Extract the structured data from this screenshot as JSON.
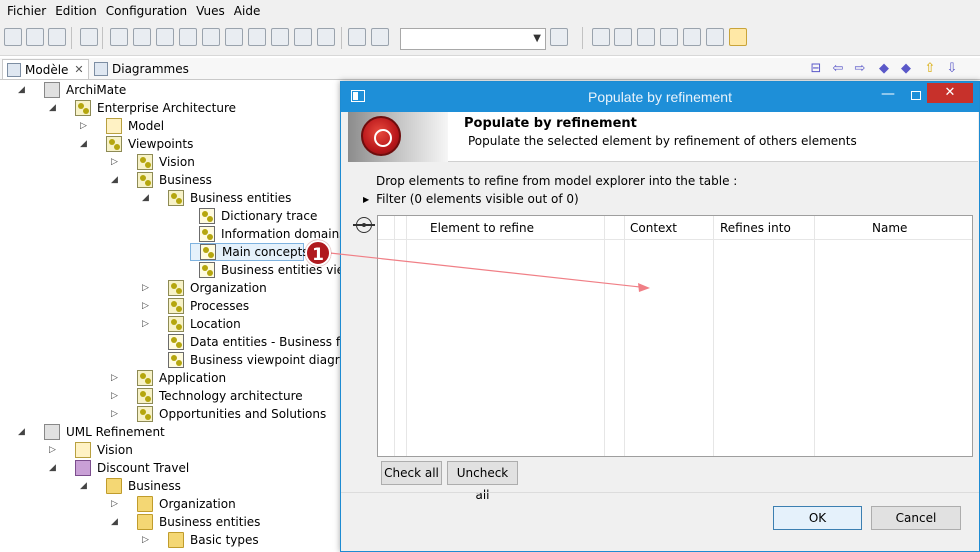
{
  "menu": [
    "Fichier",
    "Edition",
    "Configuration",
    "Vues",
    "Aide"
  ],
  "tabs": {
    "model": "Modèle",
    "model_close": "✕",
    "diagrams": "Diagrammes"
  },
  "tree": [
    {
      "label": "ArchiMate",
      "icon": "project-icon",
      "twisty": "expanded"
    },
    {
      "label": "Enterprise Architecture",
      "icon": "viewpoint-icon",
      "twisty": "expanded"
    },
    {
      "label": "Model",
      "icon": "package-icon",
      "twisty": "collapsed"
    },
    {
      "label": "Viewpoints",
      "icon": "viewpoint-icon",
      "twisty": "expanded"
    },
    {
      "label": "Vision",
      "icon": "viewpoint-icon",
      "twisty": "collapsed"
    },
    {
      "label": "Business",
      "icon": "viewpoint-icon",
      "twisty": "expanded"
    },
    {
      "label": "Business entities",
      "icon": "viewpoint-icon",
      "twisty": "expanded"
    },
    {
      "label": "Dictionary trace",
      "icon": "diagram-icon",
      "twisty": "none"
    },
    {
      "label": "Information domains",
      "icon": "diagram-icon",
      "twisty": "none"
    },
    {
      "label": "Main concepts",
      "icon": "diagram-icon",
      "twisty": "none"
    },
    {
      "label": "Business entities viewp",
      "icon": "diagram-icon",
      "twisty": "none"
    },
    {
      "label": "Organization",
      "icon": "viewpoint-icon",
      "twisty": "collapsed"
    },
    {
      "label": "Processes",
      "icon": "viewpoint-icon",
      "twisty": "collapsed"
    },
    {
      "label": "Location",
      "icon": "viewpoint-icon",
      "twisty": "collapsed"
    },
    {
      "label": "Data entities - Business func",
      "icon": "diagram-icon",
      "twisty": "none"
    },
    {
      "label": "Business viewpoint diagram",
      "icon": "diagram-icon",
      "twisty": "none"
    },
    {
      "label": "Application",
      "icon": "viewpoint-icon",
      "twisty": "collapsed"
    },
    {
      "label": "Technology architecture",
      "icon": "viewpoint-icon",
      "twisty": "collapsed"
    },
    {
      "label": "Opportunities and Solutions",
      "icon": "viewpoint-icon",
      "twisty": "collapsed"
    },
    {
      "label": "UML Refinement",
      "icon": "project-icon",
      "twisty": "expanded"
    },
    {
      "label": "Vision",
      "icon": "package-icon",
      "twisty": "collapsed"
    },
    {
      "label": "Discount Travel",
      "icon": "cube-icon",
      "twisty": "expanded"
    },
    {
      "label": "Business",
      "icon": "folder-icon",
      "twisty": "expanded"
    },
    {
      "label": "Organization",
      "icon": "folder-icon",
      "twisty": "collapsed"
    },
    {
      "label": "Business entities",
      "icon": "folder-icon",
      "twisty": "expanded"
    },
    {
      "label": "Basic types",
      "icon": "folder-icon",
      "twisty": "collapsed"
    }
  ],
  "badge": "1",
  "dialog": {
    "title": "Populate by refinement",
    "header_title": "Populate by refinement",
    "header_subtitle": "Populate the selected element by refinement of others elements",
    "drop_message": "Drop elements to refine from model explorer into the table :",
    "filter": "Filter (0 elements visible out of 0)",
    "columns": [
      "Element to refine",
      "Context",
      "Refines into",
      "Name"
    ],
    "check_all": "Check all",
    "uncheck_all": "Uncheck all",
    "ok": "OK",
    "cancel": "Cancel",
    "close_glyph": "✕",
    "minimize_glyph": "—"
  },
  "colors": {
    "title_bar": "#1e8fd8",
    "close_button": "#c7312b",
    "badge": "#b0191e",
    "arrow": "#f07f86"
  }
}
